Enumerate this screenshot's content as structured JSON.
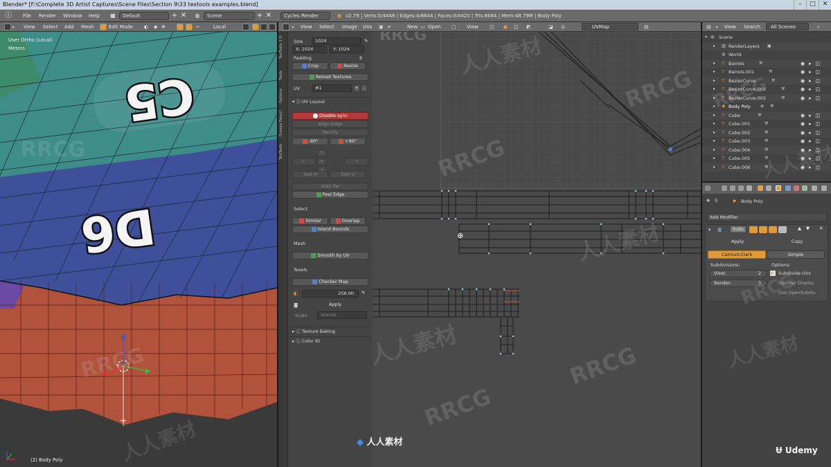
{
  "window": {
    "title": "Blender* [F:\\Complete 3D Artist Captures\\Scene Files\\Section 9\\33 textools examples.blend]",
    "controls": [
      "–",
      "□",
      "✕"
    ]
  },
  "topbar": {
    "menus": [
      "File",
      "Render",
      "Window",
      "Help"
    ],
    "layout": "Default",
    "scene": "Scene",
    "engine": "Cycles Render",
    "stats": "v2.79 | Verts:5/4448 | Edges:4/8644 | Faces:0/4420 | Tris:8684 | Mem:48.79M | Body Poly"
  },
  "viewport3d": {
    "menus": [
      "View",
      "Select",
      "Add",
      "Mesh"
    ],
    "mode": "Edit Mode",
    "pivot": "Local",
    "overlay_view": "User Ortho (Local)",
    "overlay_units": "Meters",
    "status": "(2) Body Poly"
  },
  "uv_editor": {
    "menus": [
      "View",
      "Select",
      "Image",
      "UVs"
    ],
    "open_label": "Open",
    "view_label": "View",
    "uvmap": "UVMap"
  },
  "toolshelf": {
    "tabs": [
      "TexTools 1.0",
      "Tools",
      "Options",
      "Grease Pencil",
      "TexTools"
    ],
    "size_label": "Size",
    "size_value": "1024",
    "x_label": "X:",
    "x_value": "1024",
    "y_label": "Y:",
    "y_value": "1024",
    "padding_label": "Padding",
    "padding_value": "8",
    "crop": "Crop",
    "resize": "Resize",
    "reload": "Reload Textures",
    "uv_label": "UV",
    "uv_value": "#1",
    "uv_layout_header": "UV Layout",
    "disable_sync": "Disable sync",
    "align_edge": "Align Edge",
    "rectify": "Rectify",
    "rot_neg": "-90°",
    "rot_pos": "+90°",
    "sort_h": "Sort H",
    "sort_v": "Sort V",
    "island_far": "Islan Far",
    "peel_edge": "Peel Edge",
    "select_header": "Select",
    "similar": "Similar",
    "overlap": "Overlap",
    "island_bounds": "Island Bounds",
    "mesh_header": "Mesh",
    "smooth_uv": "Smooth by UV",
    "texels_header": "Texels",
    "checker_map": "Checker Map",
    "texel_value": "256.00",
    "apply": "Apply",
    "scale_label": "Scale",
    "scale_value": "Islands",
    "texture_baking": "Texture Baking",
    "color_id": "Color ID"
  },
  "outliner": {
    "menus": [
      "View",
      "Search"
    ],
    "filter": "All Scenes",
    "items": [
      {
        "name": "Scene",
        "indent": 0,
        "type": "scene"
      },
      {
        "name": "RenderLayers",
        "indent": 1,
        "type": "layers"
      },
      {
        "name": "World",
        "indent": 1,
        "type": "world"
      },
      {
        "name": "Barrels",
        "indent": 1,
        "type": "object"
      },
      {
        "name": "Barrels.001",
        "indent": 1,
        "type": "object"
      },
      {
        "name": "BezierCurve",
        "indent": 1,
        "type": "object"
      },
      {
        "name": "BezierCurve.001",
        "indent": 1,
        "type": "object"
      },
      {
        "name": "BezierCurve.002",
        "indent": 1,
        "type": "object"
      },
      {
        "name": "Body Poly",
        "indent": 1,
        "type": "object"
      },
      {
        "name": "Cube",
        "indent": 1,
        "type": "object"
      },
      {
        "name": "Cube.001",
        "indent": 1,
        "type": "object"
      },
      {
        "name": "Cube.002",
        "indent": 1,
        "type": "object"
      },
      {
        "name": "Cube.003",
        "indent": 1,
        "type": "object"
      },
      {
        "name": "Cube.004",
        "indent": 1,
        "type": "object"
      },
      {
        "name": "Cube.005",
        "indent": 1,
        "type": "object"
      },
      {
        "name": "Cube.006",
        "indent": 1,
        "type": "object"
      }
    ]
  },
  "properties": {
    "object_name": "Body Poly",
    "add_modifier": "Add Modifier",
    "modifier_name": "Subs",
    "apply": "Apply",
    "copy": "Copy",
    "catmull": "Catmull-Clark",
    "simple": "Simple",
    "subdivisions_label": "Subdivisions:",
    "options_label": "Options:",
    "view_label": "View:",
    "view_value": "2",
    "render_label": "Render:",
    "render_value": "3",
    "subdivide_uvs": "Subdivide UVs",
    "optimal_display": "Optimal Display",
    "use_opensubdiv": "Use OpenSubdiv"
  },
  "model": {
    "label_top": "C5",
    "label_mid": "D6"
  },
  "branding": {
    "udemy": "Udemy",
    "cg_logo": "人人素材",
    "watermark_latin": "RRCG",
    "watermark_cjk": "人人素材"
  },
  "colors": {
    "teal_face": "#3e8d8a",
    "blue_face": "#3f4f9a",
    "red_side": "#b0523c",
    "accent_orange": "#e09a3c",
    "selected_blue": "#5680c2"
  }
}
